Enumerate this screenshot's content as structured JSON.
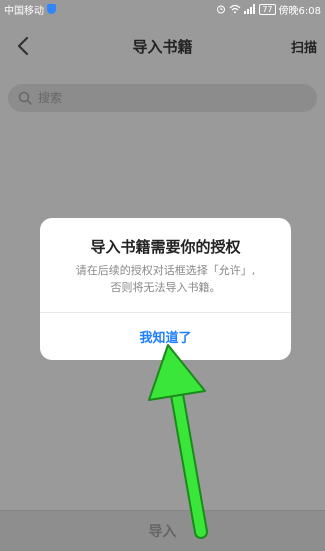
{
  "status_bar": {
    "carrier": "中国移动",
    "battery": "77",
    "time": "傍晚6:08"
  },
  "nav": {
    "title": "导入书籍",
    "scan_label": "扫描"
  },
  "search": {
    "placeholder": "搜索"
  },
  "dialog": {
    "title": "导入书籍需要你的授权",
    "message_line1": "请在后续的授权对话框选择「允许」,",
    "message_line2": "否则将无法导入书籍。",
    "button_label": "我知道了"
  },
  "bottom": {
    "import_label": "导入"
  },
  "colors": {
    "accent": "#1f7fff",
    "annotation_arrow": "#39e639"
  },
  "icons": [
    "shield-icon",
    "alarm-icon",
    "wifi-icon",
    "signal-icon",
    "battery-icon",
    "back-arrow-icon",
    "search-icon"
  ]
}
